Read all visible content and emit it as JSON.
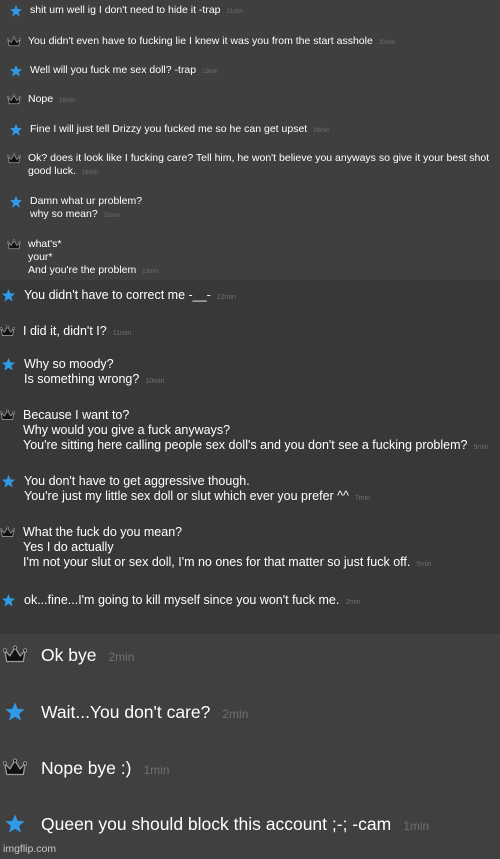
{
  "messages": [
    {
      "sender": "star",
      "lines": [
        "shit um well ig I don't need to hide it -trap"
      ],
      "time": "21min"
    },
    {
      "sender": "crown",
      "lines": [
        "You didn't even have to fucking lie I knew it was you from the start asshole"
      ],
      "time": "20min"
    },
    {
      "sender": "star",
      "lines": [
        "Well will you fuck me sex doll? -trap"
      ],
      "time": "19min"
    },
    {
      "sender": "crown",
      "lines": [
        "Nope"
      ],
      "time": "19min"
    },
    {
      "sender": "star",
      "lines": [
        "Fine I will just tell Drizzy you fucked me so he can get upset"
      ],
      "time": "18min"
    },
    {
      "sender": "crown",
      "lines": [
        "Ok? does it look like I fucking care? Tell him, he won't believe you anyways so give it your best shot",
        "good luck."
      ],
      "time": "16min"
    },
    {
      "sender": "star",
      "lines": [
        "Damn what ur problem?",
        "why so mean?"
      ],
      "time": "15min"
    },
    {
      "sender": "crown",
      "lines": [
        "what's*",
        "your*",
        "And you're the problem"
      ],
      "time": "13min"
    },
    {
      "sender": "star",
      "lines": [
        "You didn't have to correct me -__-"
      ],
      "time": "12min"
    },
    {
      "sender": "crown",
      "lines": [
        "I did it, didn't I?"
      ],
      "time": "11min"
    },
    {
      "sender": "star",
      "lines": [
        "Why so moody?",
        "Is something wrong?"
      ],
      "time": "10min"
    },
    {
      "sender": "crown",
      "lines": [
        "Because I want to?",
        "Why would you give a fuck anyways?",
        "You're sitting here calling people sex doll's and you don't see a fucking problem?"
      ],
      "time": "9min"
    },
    {
      "sender": "star",
      "lines": [
        "You don't have to get aggressive though.",
        "You're just my little sex doll or slut which ever you prefer ^^"
      ],
      "time": "7min"
    },
    {
      "sender": "crown",
      "lines": [
        "What the fuck do you mean?",
        "Yes I do actually",
        "I'm not your slut or sex doll, I'm no ones for that matter so just fuck off."
      ],
      "time": "5min"
    },
    {
      "sender": "star",
      "lines": [
        "ok...fine...I'm going to kill myself since you won't fuck me."
      ],
      "time": "2min"
    },
    {
      "sender": "crown",
      "lines": [
        "Ok bye"
      ],
      "time": "2min"
    },
    {
      "sender": "star",
      "lines": [
        "Wait...You don't care?"
      ],
      "time": "2min"
    },
    {
      "sender": "crown",
      "lines": [
        "Nope bye :)"
      ],
      "time": "1min"
    },
    {
      "sender": "star",
      "lines": [
        "Queen you should block this account ;-; -cam"
      ],
      "time": "1min"
    }
  ],
  "watermark": "imgflip.com",
  "colors": {
    "star": "#2f9be6",
    "crown": "#111111",
    "crown_outline": "#9a9a9a",
    "timestamp": "#6f6f6f",
    "text": "#ffffff"
  }
}
